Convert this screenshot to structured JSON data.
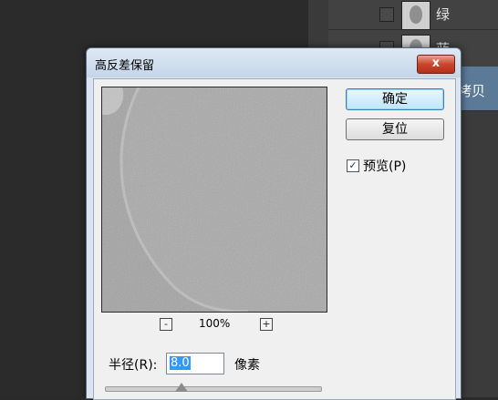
{
  "layers": {
    "rows": [
      {
        "label": "绿"
      },
      {
        "label": "蓝"
      },
      {
        "label": "拷贝"
      }
    ]
  },
  "dialog": {
    "title": "高反差保留",
    "close_label": "x",
    "ok_label": "确定",
    "reset_label": "复位",
    "preview_check": "✓",
    "preview_label": "预览(P)",
    "zoom_minus": "-",
    "zoom_plus": "+",
    "zoom_level": "100%",
    "radius_label": "半径(R):",
    "radius_value": "8.0",
    "radius_unit": "像素"
  }
}
